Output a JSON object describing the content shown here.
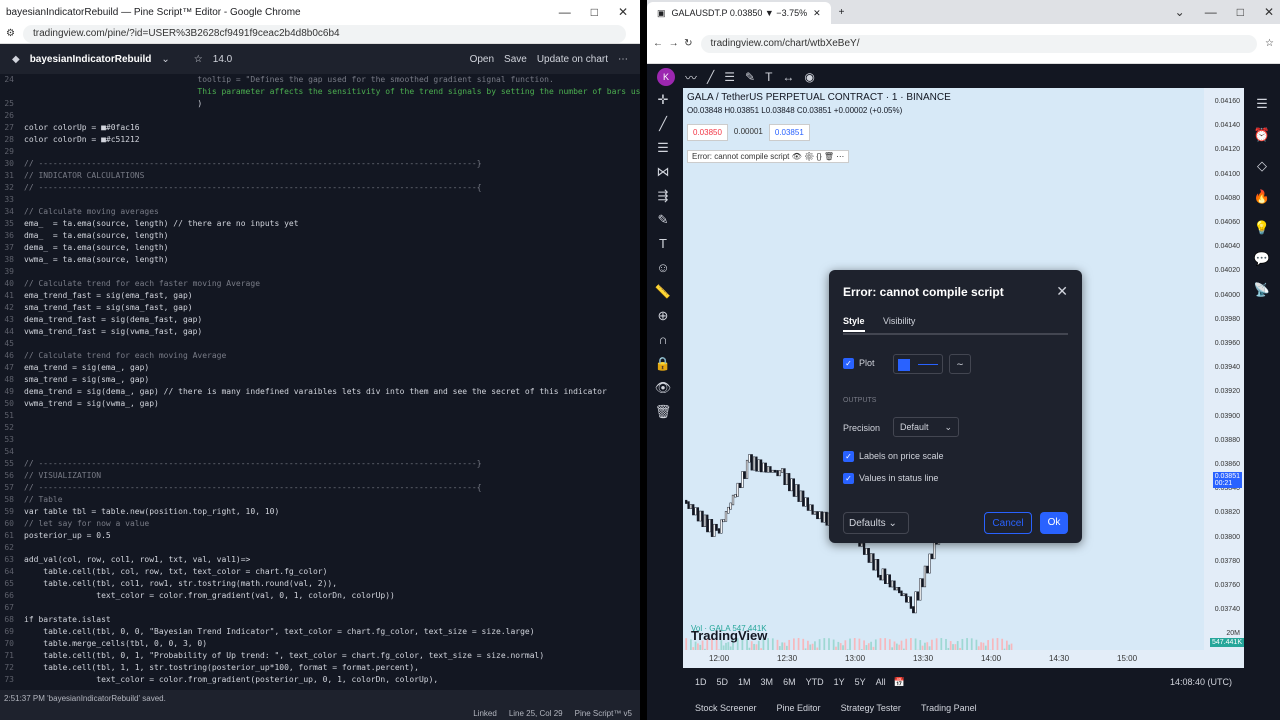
{
  "left_window": {
    "title": "bayesianIndicatorRebuild — Pine Script™ Editor - Google Chrome",
    "url": "tradingview.com/pine/?id=USER%3B2628cf9491f9ceac2b4d8b0c6b4",
    "script_name": "bayesianIndicatorRebuild",
    "version": "14.0",
    "toolbar": {
      "open": "Open",
      "save": "Save",
      "update": "Update on chart"
    },
    "code": [
      {
        "n": "24",
        "t": "                                    tooltip = \"Defines the gap used for the smoothed gradient signal function.",
        "c": "cm"
      },
      {
        "n": "",
        "t": "                                    This parameter affects the sensitivity of the trend signals by setting the number of bars used in",
        "c": "cm2"
      },
      {
        "n": "25",
        "t": "                                    )",
        "c": ""
      },
      {
        "n": "26",
        "t": "",
        "c": ""
      },
      {
        "n": "27",
        "t": "color colorUp = ■#0fac16",
        "c": ""
      },
      {
        "n": "28",
        "t": "color colorDn = ■#c51212",
        "c": ""
      },
      {
        "n": "29",
        "t": "",
        "c": ""
      },
      {
        "n": "30",
        "t": "// -------------------------------------------------------------------------------------------}",
        "c": "cm"
      },
      {
        "n": "31",
        "t": "// INDICATOR CALCULATIONS",
        "c": "cm"
      },
      {
        "n": "32",
        "t": "// -------------------------------------------------------------------------------------------{",
        "c": "cm"
      },
      {
        "n": "33",
        "t": "",
        "c": ""
      },
      {
        "n": "34",
        "t": "// Calculate moving averages",
        "c": "cm"
      },
      {
        "n": "35",
        "t": "ema_  = ta.ema(source, length) // there are no inputs yet",
        "c": ""
      },
      {
        "n": "36",
        "t": "dma_  = ta.ema(source, length)",
        "c": ""
      },
      {
        "n": "37",
        "t": "dema_ = ta.ema(source, length)",
        "c": ""
      },
      {
        "n": "38",
        "t": "vwma_ = ta.ema(source, length)",
        "c": ""
      },
      {
        "n": "39",
        "t": "",
        "c": ""
      },
      {
        "n": "40",
        "t": "// Calculate trend for each faster moving Average",
        "c": "cm"
      },
      {
        "n": "41",
        "t": "ema_trend_fast = sig(ema_fast, gap)",
        "c": ""
      },
      {
        "n": "42",
        "t": "sma_trend_fast = sig(sma_fast, gap)",
        "c": ""
      },
      {
        "n": "43",
        "t": "dema_trend_fast = sig(dema_fast, gap)",
        "c": ""
      },
      {
        "n": "44",
        "t": "vwma_trend_fast = sig(vwma_fast, gap)",
        "c": ""
      },
      {
        "n": "45",
        "t": "",
        "c": ""
      },
      {
        "n": "46",
        "t": "// Calculate trend for each moving Average",
        "c": "cm"
      },
      {
        "n": "47",
        "t": "ema_trend = sig(ema_, gap)",
        "c": ""
      },
      {
        "n": "48",
        "t": "sma_trend = sig(sma_, gap)",
        "c": ""
      },
      {
        "n": "49",
        "t": "dema_trend = sig(dema_, gap) // there is many indefined varaibles lets div into them and see the secret of this indicator",
        "c": ""
      },
      {
        "n": "50",
        "t": "vwma_trend = sig(vwma_, gap)",
        "c": ""
      },
      {
        "n": "51",
        "t": "",
        "c": ""
      },
      {
        "n": "52",
        "t": "",
        "c": ""
      },
      {
        "n": "53",
        "t": "",
        "c": ""
      },
      {
        "n": "54",
        "t": "",
        "c": ""
      },
      {
        "n": "55",
        "t": "// -------------------------------------------------------------------------------------------}",
        "c": "cm"
      },
      {
        "n": "56",
        "t": "// VISUALIZATION",
        "c": "cm"
      },
      {
        "n": "57",
        "t": "// -------------------------------------------------------------------------------------------{",
        "c": "cm"
      },
      {
        "n": "58",
        "t": "// Table",
        "c": "cm"
      },
      {
        "n": "59",
        "t": "var table tbl = table.new(position.top_right, 10, 10)",
        "c": ""
      },
      {
        "n": "60",
        "t": "// let say for now a value",
        "c": "cm"
      },
      {
        "n": "61",
        "t": "posterior_up = 0.5",
        "c": ""
      },
      {
        "n": "62",
        "t": "",
        "c": ""
      },
      {
        "n": "63",
        "t": "add_val(col, row, col1, row1, txt, val, val1)=>",
        "c": ""
      },
      {
        "n": "64",
        "t": "    table.cell(tbl, col, row, txt, text_color = chart.fg_color)",
        "c": ""
      },
      {
        "n": "65",
        "t": "    table.cell(tbl, col1, row1, str.tostring(math.round(val, 2)),",
        "c": ""
      },
      {
        "n": "66",
        "t": "               text_color = color.from_gradient(val, 0, 1, colorDn, colorUp))",
        "c": ""
      },
      {
        "n": "67",
        "t": "",
        "c": ""
      },
      {
        "n": "68",
        "t": "if barstate.islast",
        "c": ""
      },
      {
        "n": "69",
        "t": "    table.cell(tbl, 0, 0, \"Bayesian Trend Indicator\", text_color = chart.fg_color, text_size = size.large)",
        "c": ""
      },
      {
        "n": "70",
        "t": "    table.merge_cells(tbl, 0, 0, 3, 0)",
        "c": ""
      },
      {
        "n": "71",
        "t": "    table.cell(tbl, 0, 1, \"Probability of Up trend: \", text_color = chart.fg_color, text_size = size.normal)",
        "c": ""
      },
      {
        "n": "72",
        "t": "    table.cell(tbl, 1, 1, str.tostring(posterior_up*100, format = format.percent),",
        "c": ""
      },
      {
        "n": "73",
        "t": "               text_color = color.from_gradient(posterior_up, 0, 1, colorDn, colorUp),",
        "c": ""
      }
    ],
    "footer": {
      "message": "2:51:37 PM  'bayesianIndicatorRebuild' saved.",
      "linked": "Linked",
      "pos": "Line 25, Col 29",
      "lang": "Pine Script™ v5"
    }
  },
  "right_window": {
    "tab_title": "GALAUSDT.P 0.03850 ▼ −3.75%",
    "url": "tradingview.com/chart/wtbXeBeY/",
    "symbol_line": "GALA / TetherUS PERPETUAL CONTRACT · 1 · BINANCE",
    "ohlc": "O0.03848 H0.03851 L0.03848 C0.03851 +0.00002 (+0.05%)",
    "bid": "0.03850",
    "spread": "0.00001",
    "ask": "0.03851",
    "indicator_label": "Error: cannot compile script",
    "price_ticks": [
      "0.04160",
      "0.04140",
      "0.04120",
      "0.04100",
      "0.04080",
      "0.04060",
      "0.04040",
      "0.04020",
      "0.04000",
      "0.03980",
      "0.03960",
      "0.03940",
      "0.03920",
      "0.03900",
      "0.03880",
      "0.03860",
      "0.03840",
      "0.03820",
      "0.03800",
      "0.03780",
      "0.03760",
      "0.03740",
      "20M"
    ],
    "last_price": "0.03851",
    "last_time": "00:21",
    "vol_tag": "547.441K",
    "vol_label": "Vol · GALA  547.441K",
    "time_ticks": [
      "12:00",
      "12:30",
      "13:00",
      "13:30",
      "14:00",
      "14:30",
      "15:00"
    ],
    "ranges": [
      "1D",
      "5D",
      "1M",
      "3M",
      "6M",
      "YTD",
      "1Y",
      "5Y",
      "All"
    ],
    "clock": "14:08:40 (UTC)",
    "bottom_tabs": [
      "Stock Screener",
      "Pine Editor",
      "Strategy Tester",
      "Trading Panel"
    ],
    "logo": "TradingView",
    "dialog": {
      "title": "Error: cannot compile script",
      "tabs": [
        "Style",
        "Visibility"
      ],
      "plot": "Plot",
      "outputs": "OUTPUTS",
      "precision_label": "Precision",
      "precision_value": "Default",
      "labels_on_scale": "Labels on price scale",
      "values_in_status": "Values in status line",
      "defaults": "Defaults",
      "cancel": "Cancel",
      "ok": "Ok"
    },
    "colors": {
      "plot": "#2962ff",
      "accent": "#2962ff",
      "chart_bg": "#d7e9f7"
    }
  },
  "chart_data": {
    "type": "candlestick",
    "x": [
      "11:45",
      "12:00",
      "12:15",
      "12:30",
      "12:45",
      "13:00",
      "13:15",
      "13:30",
      "13:45",
      "14:00",
      "14:08"
    ],
    "close": [
      0.0386,
      0.03835,
      0.0389,
      0.0388,
      0.0385,
      0.0384,
      0.03805,
      0.0378,
      0.0385,
      0.03865,
      0.03851
    ],
    "ylim": [
      0.0374,
      0.0417
    ]
  }
}
